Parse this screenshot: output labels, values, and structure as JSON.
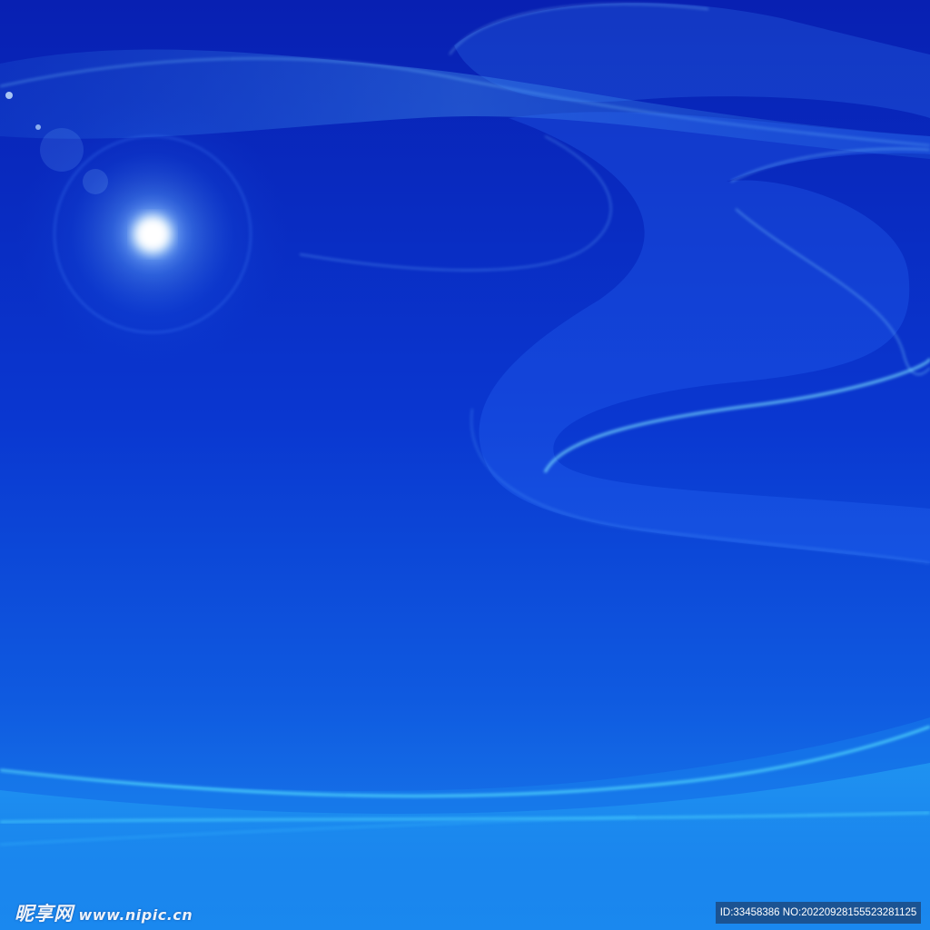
{
  "image": {
    "colors": {
      "deep_blue": "#0722b0",
      "mid_blue": "#0a3fd6",
      "bright_blue": "#1a8af0",
      "cyan_glow": "#39d8ff",
      "sun_core": "#ffffff"
    }
  },
  "watermark": {
    "logo_text": "昵享网",
    "site_url": "www.nipic.cn",
    "id_text": "ID:33458386 NO:20220928155523281125"
  }
}
